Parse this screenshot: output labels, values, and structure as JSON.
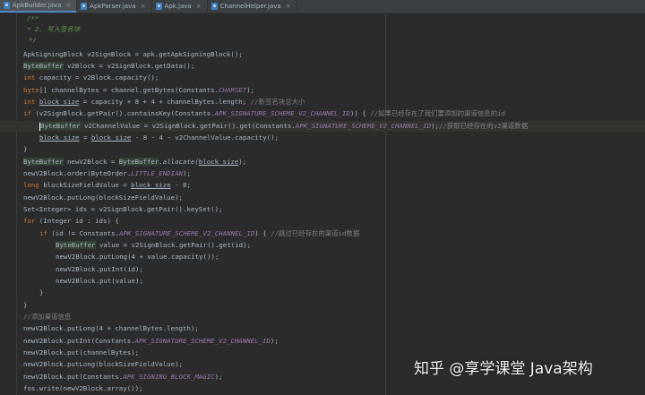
{
  "tabs": [
    {
      "label": "ApkBuilder.java",
      "active": true
    },
    {
      "label": "ApkParser.java",
      "active": false
    },
    {
      "label": "Apk.java",
      "active": false
    },
    {
      "label": "ChannelHelper.java",
      "active": false
    }
  ],
  "code": {
    "doc_open": "/**",
    "doc_step": "* 2. 写入签名块",
    "doc_close": "*/",
    "l1": "ApkSigningBlock v2SignBlock = apk.getApkSigningBlock();",
    "l2_type": "ByteBuffer",
    "l2_rest": " v2Block = v2SignBlock.getData();",
    "l3_kw": "int",
    "l3_rest": " capacity = v2Block.capacity();",
    "l4_kw": "byte",
    "l4_rest": "[] channelBytes = channel.getBytes(Constants.",
    "l4_const": "CHARSET",
    "l4_end": ");",
    "l5_kw": "int",
    "l5_var": "block_size",
    "l5_rest": " = capacity + 8 + 4 + channelBytes.length;",
    "l5_comment": "//新签名块总大小",
    "l6_kw": "if",
    "l6_rest": " (v2SignBlock.getPair().containsKey(Constants.",
    "l6_const": "APK_SIGNATURE_SCHEME_V2_CHANNEL_ID",
    "l6_end": ")) {",
    "l6_comment": "//如果已经存在了我们要添加的渠道信息的id",
    "l7_type": "ByteBuffer",
    "l7_rest": " v2ChannelValue = v2SignBlock.getPair().get(Constants.",
    "l7_const": "APK_SIGNATURE_SCHEME_V2_CHANNEL_ID",
    "l7_end": ");",
    "l7_comment": "//获取已经存在的v2渠道数据",
    "l8_var1": "block_size",
    "l8_mid": " = ",
    "l8_var2": "block_size",
    "l8_rest": " - 8 - 4 - v2ChannelValue.capacity();",
    "l9": "}",
    "l10_type": "ByteBuffer",
    "l10_mid": " newV2Block = ",
    "l10_type2": "ByteBuffer",
    "l10_call": ".allocate(",
    "l10_var": "block_size",
    "l10_end": ");",
    "l11_pre": "newV2Block.order(ByteOrder.",
    "l11_const": "LITTLE_ENDIAN",
    "l11_end": ");",
    "l12_kw": "long",
    "l12_mid": " blockSizeFieldValue = ",
    "l12_var": "block_size",
    "l12_end": " - 8;",
    "l13": "newV2Block.putLong(blockSizeFieldValue);",
    "l14": "Set<Integer> ids = v2SignBlock.getPair().keySet();",
    "l15_kw": "for",
    "l15_rest": " (Integer id : ids) {",
    "l16_kw": "if",
    "l16_rest": " (id != Constants.",
    "l16_const": "APK_SIGNATURE_SCHEME_V2_CHANNEL_ID",
    "l16_end": ") {",
    "l16_comment": "//跳过已经存在的渠道id数据",
    "l17_type": "ByteBuffer",
    "l17_rest": " value = v2SignBlock.getPair().get(id);",
    "l18": "newV2Block.putLong(4 + value.capacity());",
    "l19": "newV2Block.putInt(id);",
    "l20": "newV2Block.put(value);",
    "l21": "}",
    "l22": "}",
    "l23_comment": "//添加渠道信息",
    "l24": "newV2Block.putLong(4 + channelBytes.length);",
    "l25_pre": "newV2Block.putInt(Constants.",
    "l25_const": "APK_SIGNATURE_SCHEME_V2_CHANNEL_ID",
    "l25_end": ");",
    "l26": "newV2Block.put(channelBytes);",
    "l27": "newV2Block.putLong(blockSizeFieldValue);",
    "l28_pre": "newV2Block.put(Constants.",
    "l28_const": "APK_SIGNING_BLOCK_MAGIC",
    "l28_end": ");",
    "l29": "fos.write(newV2Block.array());"
  },
  "watermark": "知乎 @享学课堂 Java架构"
}
